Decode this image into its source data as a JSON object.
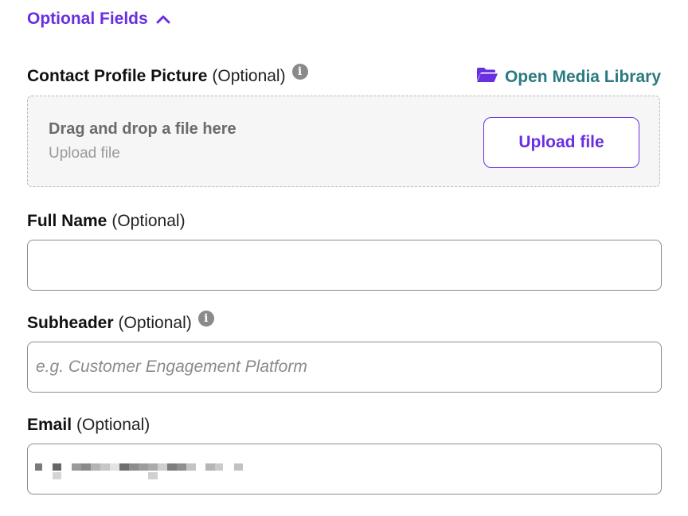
{
  "optional_section": {
    "toggle_label": "Optional Fields",
    "toggle_icon": "chevron-up-icon",
    "accent_color": "#6a2fe0"
  },
  "profile_picture": {
    "label": "Contact Profile Picture",
    "optional_text": "(Optional)",
    "info_icon": "info-icon",
    "media_library_label": "Open Media Library",
    "media_library_icon": "folder-open-icon",
    "media_library_color": "#2a7a82",
    "dropzone_title": "Drag and drop a file here",
    "dropzone_subtitle": "Upload file",
    "upload_button_label": "Upload file"
  },
  "full_name": {
    "label": "Full Name",
    "optional_text": "(Optional)",
    "value": "",
    "placeholder": ""
  },
  "subheader": {
    "label": "Subheader",
    "optional_text": "(Optional)",
    "info_icon": "info-icon",
    "value": "",
    "placeholder": "e.g. Customer Engagement Platform"
  },
  "email": {
    "label": "Email",
    "optional_text": "(Optional)"
  }
}
